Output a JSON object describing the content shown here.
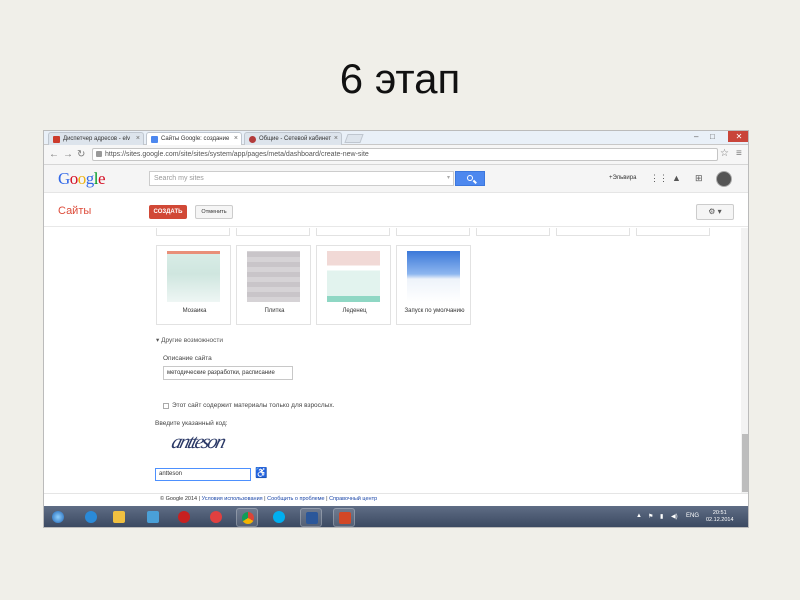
{
  "slide": {
    "title": "6 этап"
  },
  "browser": {
    "tabs": [
      {
        "label": "Диспетчер адресов - elv",
        "icon_color": "#cc3b2c"
      },
      {
        "label": "Сайты Google: создание",
        "icon_color": "#4d88ef"
      },
      {
        "label": "Общие - Сетевой кабинет",
        "icon_color": "#b33b3b"
      }
    ],
    "url": "https://sites.google.com/site/sites/system/app/pages/meta/dashboard/create-new-site",
    "window_controls": {
      "minimize": "–",
      "maximize": "□",
      "close": "✕"
    }
  },
  "google_header": {
    "logo": "Google",
    "search_placeholder": "Search my sites",
    "user_name": "+Эльвира"
  },
  "sites_bar": {
    "title": "Сайты",
    "create_label": "СОЗДАТЬ",
    "cancel_label": "Отменить"
  },
  "themes": [
    {
      "label": "Мозаика"
    },
    {
      "label": "Плитка"
    },
    {
      "label": "Леденец"
    },
    {
      "label": "Запуск по умолчанию"
    }
  ],
  "form": {
    "more_options": "Другие возможности",
    "description_label": "Описание сайта",
    "description_value": "методические разработки, расписание",
    "adult_label": "Этот сайт содержит материалы только для взрослых.",
    "captcha_label": "Введите указанный код:",
    "captcha_text": "antteson",
    "captcha_value": "antteson"
  },
  "footer": {
    "copyright": "© Google 2014 |",
    "link1": "Условия использования",
    "sep1": "|",
    "link2": "Сообщить о проблеме",
    "sep2": "|",
    "link3": "Справочный центр"
  },
  "taskbar": {
    "language": "ENG",
    "time": "20:51",
    "date": "02.12.2014"
  }
}
